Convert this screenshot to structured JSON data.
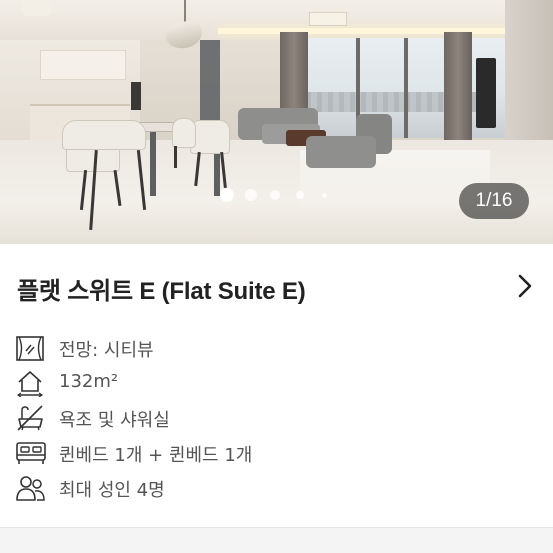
{
  "gallery": {
    "counter": "1/16",
    "current_index": 1,
    "total": 16,
    "dots_visible": 5,
    "photo_description_icon": "room-photo"
  },
  "room": {
    "title": "플랫 스위트 E (Flat Suite E)"
  },
  "features": [
    {
      "icon": "window-view-icon",
      "label": "전망: 시티뷰"
    },
    {
      "icon": "house-area-icon",
      "label": "132m²"
    },
    {
      "icon": "no-bath-icon",
      "label": "욕조 및 샤워실"
    },
    {
      "icon": "bed-icon",
      "label": "퀸베드 1개 + 퀸베드 1개"
    },
    {
      "icon": "people-icon",
      "label": "최대 성인 4명"
    }
  ],
  "colors": {
    "title_text": "#222222",
    "feature_text": "#555555",
    "icon_stroke": "#333333",
    "counter_bg": "rgba(40,40,40,.62)"
  }
}
